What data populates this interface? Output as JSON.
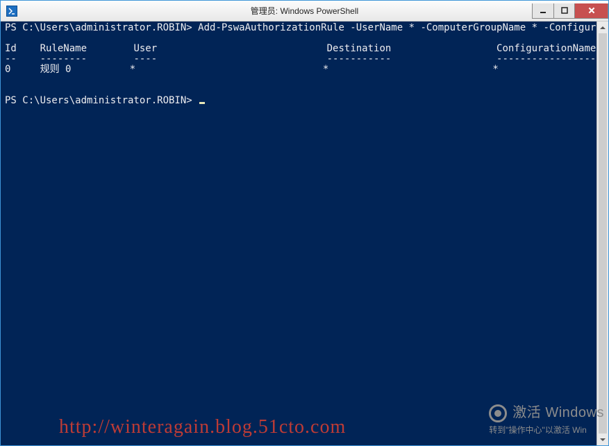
{
  "window": {
    "title": "管理员: Windows PowerShell"
  },
  "terminal": {
    "prompt1": "PS C:\\Users\\administrator.ROBIN>",
    "command": "Add-PswaAuthorizationRule -UserName * -ComputerGroupName * -ConfigurationName *",
    "blank": "",
    "headers": {
      "id": "Id",
      "rule": "RuleName",
      "user": "User",
      "dest": "Destination",
      "conf": "ConfigurationName"
    },
    "dashes": {
      "id": "--",
      "rule": "--------",
      "user": "----",
      "dest": "-----------",
      "conf": "-----------------"
    },
    "row0": {
      "id": "0",
      "rule": "规则 0",
      "user": "*",
      "dest": "*",
      "conf": "*"
    },
    "prompt2": "PS C:\\Users\\administrator.ROBIN>"
  },
  "activation": {
    "line1": "激活 Windows",
    "line2": "转到\"操作中心\"以激活 Win"
  },
  "watermark": "http://winteragain.blog.51cto.com"
}
